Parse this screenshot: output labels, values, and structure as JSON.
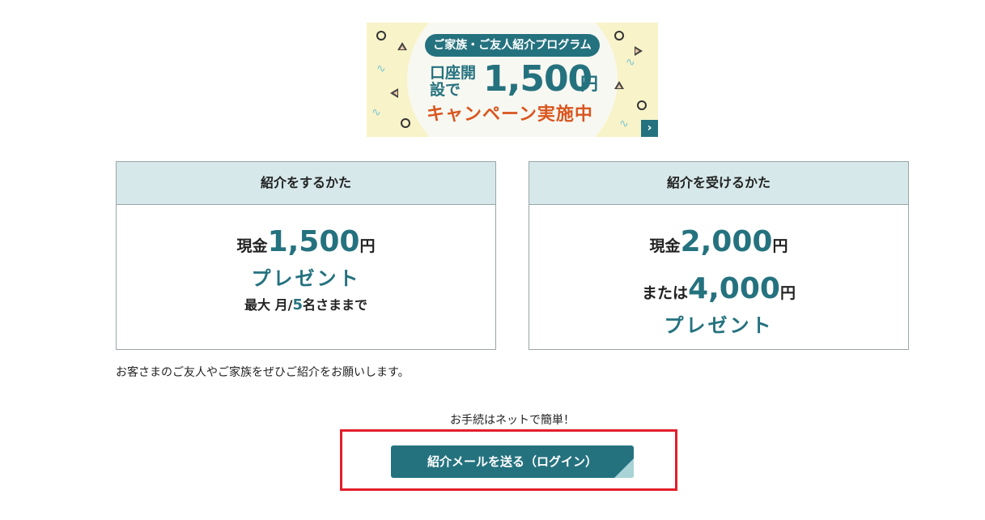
{
  "banner": {
    "tag": "ご家族・ご友人紹介プログラム",
    "line1_small": "口座開設で",
    "line1_amount": "1,500",
    "line1_yen": "円",
    "line2": "キャンペーン実施中",
    "arrow": "›",
    "colors": {
      "background": "#f8f3c8",
      "teal": "#25727f",
      "orange": "#d9561f"
    }
  },
  "cards": {
    "referrer": {
      "title": "紹介をするかた",
      "cash_label": "現金",
      "amount": "1,500",
      "yen": "円",
      "present": "プレゼント",
      "limit_prefix": "最大 月/",
      "limit_num": "5",
      "limit_suffix": "名さままで"
    },
    "referee": {
      "title": "紹介を受けるかた",
      "cash_label": "現金",
      "amount1": "2,000",
      "yen1": "円",
      "or_label": "または",
      "amount2": "4,000",
      "yen2": "円",
      "present": "プレゼント"
    }
  },
  "note": "お客さまのご友人やご家族をぜひご紹介をお願いします。",
  "easy_text": "お手続はネットで簡単！",
  "cta": {
    "label": "紹介メールを送る（ログイン）"
  },
  "colors": {
    "accent": "#25727f",
    "card_header": "#d6e8ea",
    "highlight": "#e31e2b"
  }
}
